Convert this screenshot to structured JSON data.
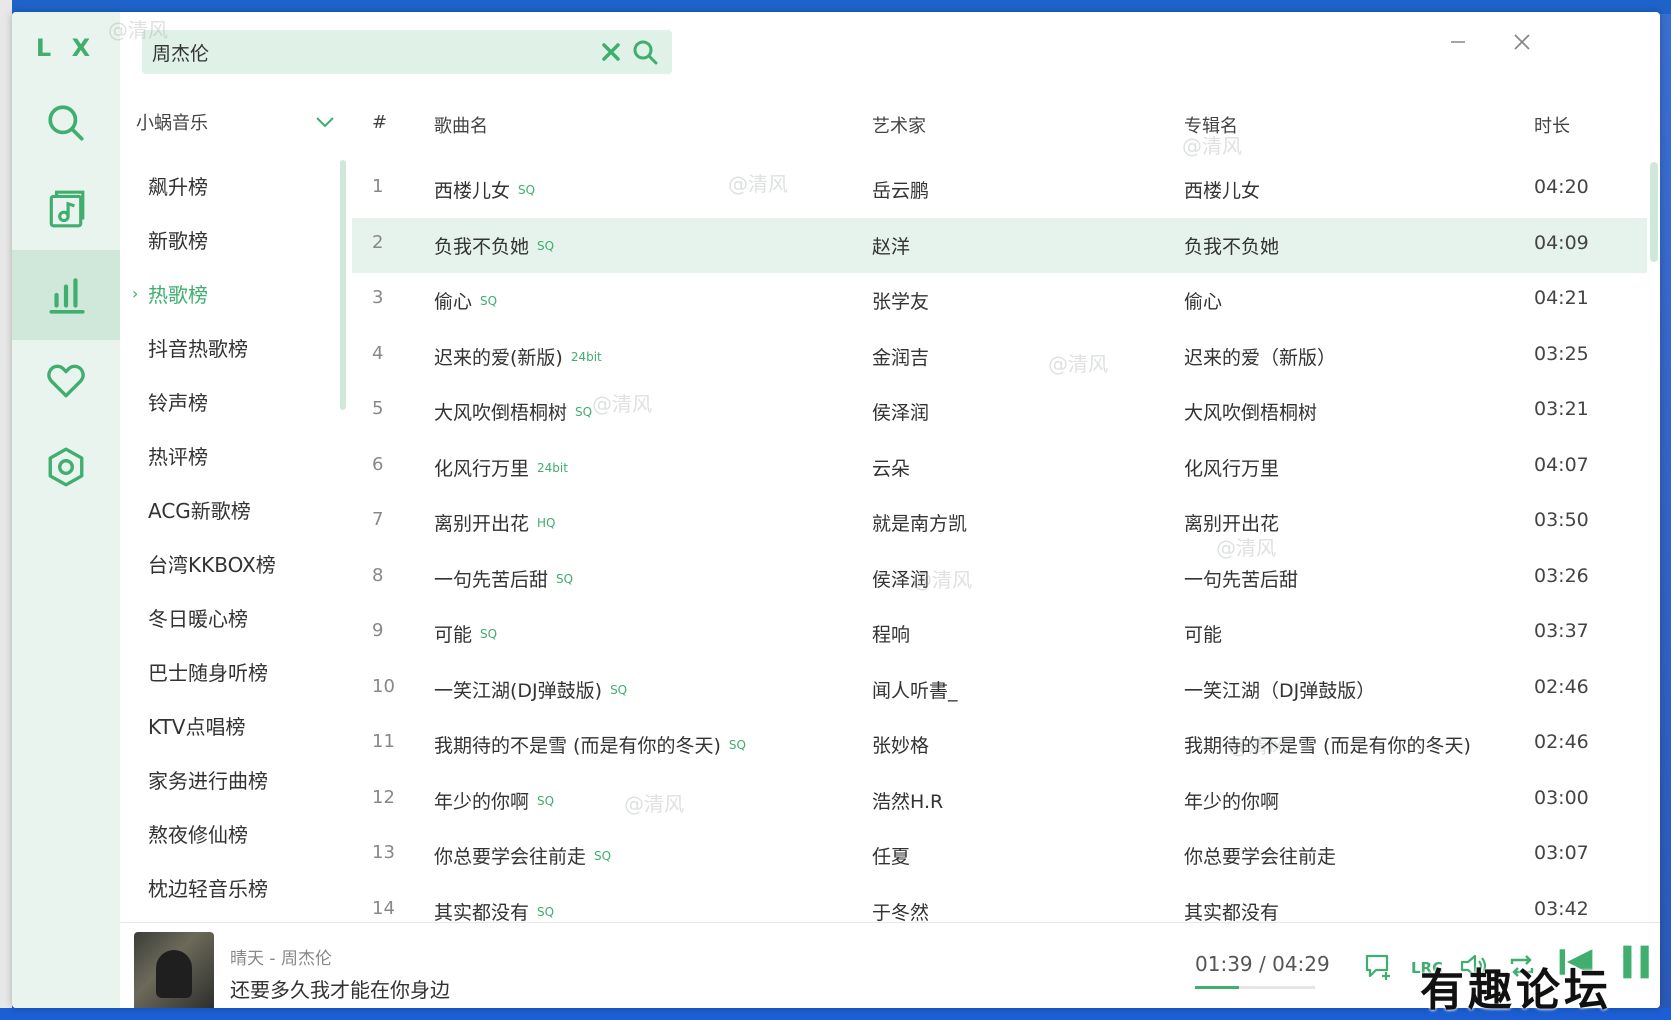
{
  "app": {
    "logo": "L X"
  },
  "colors": {
    "accent": "#3fae6f",
    "rail_bg": "#e9f4ee",
    "highlight_row": "#e6f3ec"
  },
  "search": {
    "value": "周杰伦",
    "clear_icon": "close-x-icon",
    "search_icon": "search-icon"
  },
  "rail": [
    {
      "name": "search",
      "icon": "search-icon",
      "active": false
    },
    {
      "name": "song-list",
      "icon": "music-note-list-icon",
      "active": false
    },
    {
      "name": "leaderboard",
      "icon": "bar-chart-icon",
      "active": true
    },
    {
      "name": "favorites",
      "icon": "heart-icon",
      "active": false
    },
    {
      "name": "settings",
      "icon": "hexagon-settings-icon",
      "active": false
    }
  ],
  "source": {
    "label": "小蜗音乐"
  },
  "boards": [
    {
      "label": "飙升榜",
      "active": false
    },
    {
      "label": "新歌榜",
      "active": false
    },
    {
      "label": "热歌榜",
      "active": true
    },
    {
      "label": "抖音热歌榜",
      "active": false
    },
    {
      "label": "铃声榜",
      "active": false
    },
    {
      "label": "热评榜",
      "active": false
    },
    {
      "label": "ACG新歌榜",
      "active": false
    },
    {
      "label": "台湾KKBOX榜",
      "active": false
    },
    {
      "label": "冬日暖心榜",
      "active": false
    },
    {
      "label": "巴士随身听榜",
      "active": false
    },
    {
      "label": "KTV点唱榜",
      "active": false
    },
    {
      "label": "家务进行曲榜",
      "active": false
    },
    {
      "label": "熬夜修仙榜",
      "active": false
    },
    {
      "label": "枕边轻音乐榜",
      "active": false
    }
  ],
  "table": {
    "headers": {
      "num": "#",
      "title": "歌曲名",
      "artist": "艺术家",
      "album": "专辑名",
      "duration": "时长"
    },
    "rows": [
      {
        "num": "1",
        "title": "西楼儿女",
        "tag": "SQ",
        "artist": "岳云鹏",
        "album": "西楼儿女",
        "duration": "04:20"
      },
      {
        "num": "2",
        "title": "负我不负她",
        "tag": "SQ",
        "artist": "赵洋",
        "album": "负我不负她",
        "duration": "04:09",
        "highlight": true
      },
      {
        "num": "3",
        "title": "偷心",
        "tag": "SQ",
        "artist": "张学友",
        "album": "偷心",
        "duration": "04:21"
      },
      {
        "num": "4",
        "title": "迟来的爱(新版)",
        "tag": "24bit",
        "artist": "金润吉",
        "album": "迟来的爱（新版）",
        "duration": "03:25"
      },
      {
        "num": "5",
        "title": "大风吹倒梧桐树",
        "tag": "SQ",
        "artist": "侯泽润",
        "album": "大风吹倒梧桐树",
        "duration": "03:21"
      },
      {
        "num": "6",
        "title": "化风行万里",
        "tag": "24bit",
        "artist": "云朵",
        "album": "化风行万里",
        "duration": "04:07"
      },
      {
        "num": "7",
        "title": "离别开出花",
        "tag": "HQ",
        "artist": "就是南方凯",
        "album": "离别开出花",
        "duration": "03:50"
      },
      {
        "num": "8",
        "title": "一句先苦后甜",
        "tag": "SQ",
        "artist": "侯泽润",
        "album": "一句先苦后甜",
        "duration": "03:26"
      },
      {
        "num": "9",
        "title": "可能",
        "tag": "SQ",
        "artist": "程响",
        "album": "可能",
        "duration": "03:37"
      },
      {
        "num": "10",
        "title": "一笑江湖(DJ弹鼓版)",
        "tag": "SQ",
        "artist": "闻人听書_",
        "album": "一笑江湖（DJ弹鼓版）",
        "duration": "02:46"
      },
      {
        "num": "11",
        "title": "我期待的不是雪 (而是有你的冬天)",
        "tag": "SQ",
        "artist": "张妙格",
        "album": "我期待的不是雪 (而是有你的冬天)",
        "duration": "02:46"
      },
      {
        "num": "12",
        "title": "年少的你啊",
        "tag": "SQ",
        "artist": "浩然H.R",
        "album": "年少的你啊",
        "duration": "03:00"
      },
      {
        "num": "13",
        "title": "你总要学会往前走",
        "tag": "SQ",
        "artist": "任夏",
        "album": "你总要学会往前走",
        "duration": "03:07"
      },
      {
        "num": "14",
        "title": "其实都没有",
        "tag": "SQ",
        "artist": "于冬然",
        "album": "其实都没有",
        "duration": "03:42"
      }
    ]
  },
  "player": {
    "now_playing": "晴天 - 周杰伦",
    "lyric": "还要多久我才能在你身边",
    "time": "01:39 / 04:29",
    "progress": 0.37
  },
  "watermark": "@清风",
  "forum_logo": "有趣论坛"
}
